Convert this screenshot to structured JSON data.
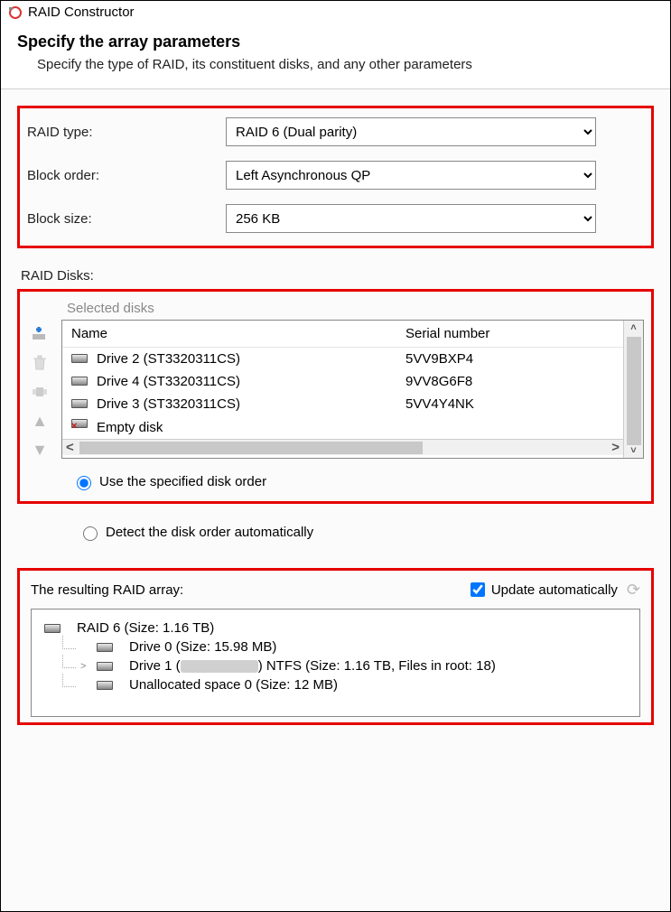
{
  "window": {
    "title": "RAID Constructor"
  },
  "header": {
    "title": "Specify the array parameters",
    "subtitle": "Specify the type of RAID, its constituent disks, and any other parameters"
  },
  "fields": {
    "raid_type": {
      "label": "RAID type:",
      "value": "RAID 6 (Dual parity)"
    },
    "block_order": {
      "label": "Block order:",
      "value": "Left Asynchronous QP"
    },
    "block_size": {
      "label": "Block size:",
      "value": "256 KB"
    }
  },
  "raid_disks": {
    "label": "RAID Disks:",
    "selected_label": "Selected disks",
    "columns": {
      "name": "Name",
      "serial": "Serial number"
    },
    "rows": [
      {
        "name": "Drive 2 (ST3320311CS)",
        "serial": "5VV9BXP4",
        "empty": false
      },
      {
        "name": "Drive 4 (ST3320311CS)",
        "serial": "9VV8G6F8",
        "empty": false
      },
      {
        "name": "Drive 3 (ST3320311CS)",
        "serial": "5VV4Y4NK",
        "empty": false
      },
      {
        "name": "Empty disk",
        "serial": "",
        "empty": true
      }
    ],
    "radio_specified": "Use the specified disk order",
    "radio_detect": "Detect the disk order automatically",
    "selected_radio": "specified"
  },
  "result": {
    "label": "The resulting RAID array:",
    "update_auto_label": "Update automatically",
    "update_auto_checked": true,
    "tree": {
      "root": "RAID 6 (Size: 1.16 TB)",
      "children": [
        {
          "label": "Drive 0 (Size: 15.98 MB)",
          "expandable": false
        },
        {
          "label_prefix": "Drive 1 (",
          "label_suffix": ") NTFS (Size: 1.16 TB, Files in root: 18)",
          "redacted": true,
          "expandable": true
        },
        {
          "label": "Unallocated space 0 (Size: 12 MB)",
          "expandable": false
        }
      ]
    }
  },
  "icons": {
    "add": "add-icon",
    "delete": "delete-icon",
    "key": "key-icon",
    "up": "arrow-up-icon",
    "down": "arrow-down-icon",
    "refresh": "refresh-icon"
  }
}
